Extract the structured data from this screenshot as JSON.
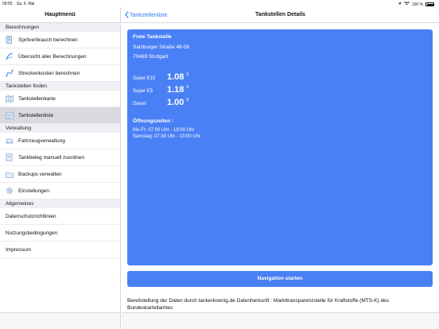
{
  "status_bar": {
    "time": "09:55",
    "date": "Sa. 9. Mai",
    "battery": "100 %"
  },
  "sidebar": {
    "title": "Hauptmenü",
    "sections": [
      {
        "header": "Berechnungen",
        "items": [
          {
            "label": "Spritverbrauch berechnen",
            "icon": "fuel-pump-icon"
          },
          {
            "label": "Übersicht aller Berechnungen",
            "icon": "chart-icon"
          },
          {
            "label": "Streckenkosten berechnen",
            "icon": "route-icon"
          }
        ]
      },
      {
        "header": "Tankstellen finden",
        "items": [
          {
            "label": "Tankstellenkarte",
            "icon": "map-icon"
          },
          {
            "label": "Tankstellenliste",
            "icon": "list-icon",
            "selected": true
          }
        ]
      },
      {
        "header": "Verwaltung",
        "items": [
          {
            "label": "Fahrzeugverwaltung",
            "icon": "car-icon"
          },
          {
            "label": "Tankbeleg manuell zuordnen",
            "icon": "receipt-icon"
          },
          {
            "label": "Backups verwalten",
            "icon": "backup-icon"
          },
          {
            "label": "Einstellungen",
            "icon": "gear-icon"
          }
        ]
      },
      {
        "header": "Allgemeines",
        "items": [
          {
            "label": "Datenschutzrichtlinien"
          },
          {
            "label": "Nutzungsbedingungen"
          },
          {
            "label": "Impressum"
          }
        ]
      }
    ]
  },
  "main": {
    "back_label": "Tankstellenliste",
    "title": "Tankstellen Details",
    "station": {
      "name": "Freie Tankstelle",
      "street": "Salzburger Straße  46-56",
      "city": "70469 Stuttgart",
      "prices": [
        {
          "fuel": "Super E10",
          "value": "1.08",
          "sup": "9"
        },
        {
          "fuel": "Super E5",
          "value": "1.18",
          "sup": "9"
        },
        {
          "fuel": "Diesel",
          "value": "1.00",
          "sup": "9"
        }
      ],
      "hours_title": "Öffnungszeiten :",
      "hours": [
        "Mo-Fr: 07:00 Uhr - 19:00 Uhr",
        "Samstag: 07:30 Uhr - 13:00 Uhr"
      ]
    },
    "navigate_button": "Navigation starten",
    "source_text": "Bereitstellung der Daten durch tankerkoenig.de Datenherkunft : Markttransparenzstelle für Kraftstoffe (MTS-K) des Bundeskartellamtes"
  },
  "colors": {
    "accent": "#4a80f6",
    "link": "#3478f6",
    "section_bg": "#efeff4",
    "selected_bg": "#d9d9de"
  }
}
